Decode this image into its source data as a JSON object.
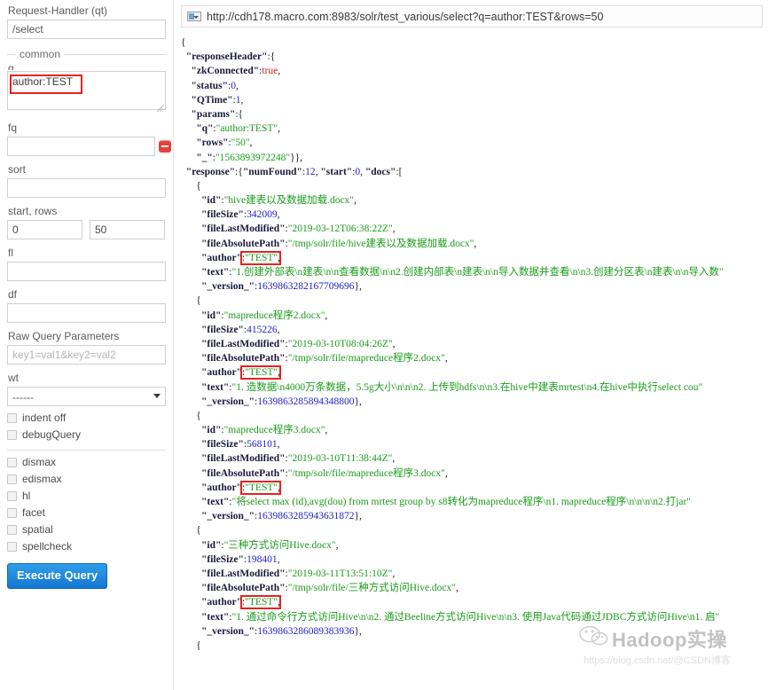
{
  "sidebar": {
    "request_handler_label": "Request-Handler (qt)",
    "request_handler_value": "/select",
    "common_legend": "common",
    "q_label": "q",
    "q_value": "author:TEST",
    "fq_label": "fq",
    "fq_value": "",
    "fq_remove_label": "-",
    "fq_add_label": "+",
    "sort_label": "sort",
    "sort_value": "",
    "start_rows_label": "start, rows",
    "start_value": "0",
    "rows_value": "50",
    "fl_label": "fl",
    "fl_value": "",
    "df_label": "df",
    "df_value": "",
    "raw_query_label": "Raw Query Parameters",
    "raw_query_placeholder": "key1=val1&key2=val2",
    "wt_label": "wt",
    "wt_value": "------",
    "checkboxes_top": [
      {
        "label": "indent off",
        "checked": false
      },
      {
        "label": "debugQuery",
        "checked": false
      }
    ],
    "checkboxes_bottom": [
      {
        "label": "dismax",
        "checked": false
      },
      {
        "label": "edismax",
        "checked": false
      },
      {
        "label": "hl",
        "checked": false
      },
      {
        "label": "facet",
        "checked": false
      },
      {
        "label": "spatial",
        "checked": false
      },
      {
        "label": "spellcheck",
        "checked": false
      }
    ],
    "execute_button": "Execute Query"
  },
  "main": {
    "url": "http://cdh178.macro.com:8983/solr/test_various/select?q=author:TEST&rows=50",
    "url_icon": "select-dropdown-icon"
  },
  "response": {
    "responseHeader": {
      "zkConnected": "true",
      "status": "0",
      "QTime": "1",
      "params": {
        "q": "author:TEST",
        "rows": "50",
        "_": "1563893972248"
      }
    },
    "response_meta": {
      "numFound": "12",
      "start": "0"
    },
    "docs": [
      {
        "id": "hive建表以及数据加载.docx",
        "fileSize": "342009",
        "fileLastModified": "2019-03-12T06:38:22Z",
        "fileAbsolutePath": "/tmp/solr/file/hive建表以及数据加载.docx",
        "author": "TEST",
        "text": "1.创建外部表\\n建表\\n\\n查看数据\\n\\n2.创建内部表\\n建表\\n\\n导入数据并查看\\n\\n3.创建分区表\\n建表\\n\\n导入数",
        "_version_": "1639863282167709696"
      },
      {
        "id": "mapreduce程序2.docx",
        "fileSize": "415226",
        "fileLastModified": "2019-03-10T08:04:26Z",
        "fileAbsolutePath": "/tmp/solr/file/mapreduce程序2.docx",
        "author": "TEST",
        "text": "1. 造数据\\n4000万条数据，5.5g大小\\n\\n\\n2. 上传到hdfs\\n\\n3.在hive中建表mrtest\\n4.在hive中执行select cou",
        "_version_": "1639863285894348800"
      },
      {
        "id": "mapreduce程序3.docx",
        "fileSize": "568101",
        "fileLastModified": "2019-03-10T11:38:44Z",
        "fileAbsolutePath": "/tmp/solr/file/mapreduce程序3.docx",
        "author": "TEST",
        "text": "将select max (id),avg(dou) from mrtest group by s8转化为mapreduce程序\\n1. mapreduce程序\\n\\n\\n\\n2.打jar",
        "_version_": "1639863285943631872"
      },
      {
        "id": "三种方式访问Hive.docx",
        "fileSize": "198401",
        "fileLastModified": "2019-03-11T13:51:10Z",
        "fileAbsolutePath": "/tmp/solr/file/三种方式访问Hive.docx",
        "author": "TEST",
        "text": "1. 通过命令行方式访问Hive\\n\\n2. 通过Beeline方式访问Hive\\n\\n3. 使用Java代码通过JDBC方式访问Hive\\n1. 启",
        "_version_": "1639863286089383936"
      }
    ]
  },
  "annotations": {
    "color": "#e8231f",
    "boxes": [
      {
        "name": "q-field-highlight",
        "target": "author:TEST"
      },
      {
        "name": "author-value-highlight-1",
        "target": "TEST"
      },
      {
        "name": "author-value-highlight-2",
        "target": "TEST"
      },
      {
        "name": "author-value-highlight-3",
        "target": "TEST"
      },
      {
        "name": "author-value-highlight-4",
        "target": "TEST"
      }
    ]
  },
  "watermark": {
    "title": "Hadoop实操",
    "subtitle": "https://blog.csdn.net/@CSDN博客",
    "icon": "wechat-icon"
  }
}
